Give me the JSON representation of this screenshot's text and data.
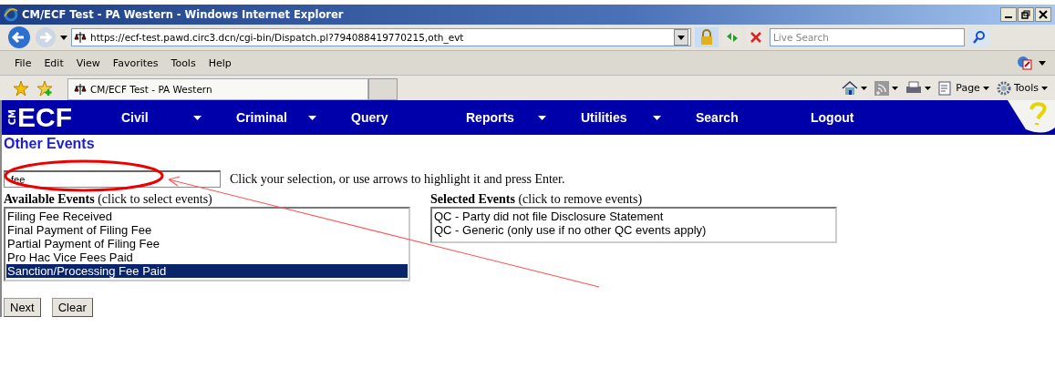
{
  "window": {
    "title": "CM/ECF Test - PA Western - Windows Internet Explorer"
  },
  "address_bar": {
    "url": "https://ecf-test.pawd.circ3.dcn/cgi-bin/Dispatch.pl?794088419770215,oth_evt"
  },
  "search": {
    "placeholder": "Live Search"
  },
  "menu_bar": [
    "File",
    "Edit",
    "View",
    "Favorites",
    "Tools",
    "Help"
  ],
  "tab": {
    "title": "CM/ECF Test - PA Western"
  },
  "command_bar": [
    {
      "kind": "home"
    },
    {
      "kind": "feed"
    },
    {
      "kind": "print"
    },
    {
      "kind": "page",
      "label": "Page"
    },
    {
      "kind": "tools",
      "label": "Tools"
    }
  ],
  "nav": {
    "logo": "ECF",
    "logo_side": "CM",
    "items": [
      {
        "label": "Civil",
        "dropdown": true
      },
      {
        "label": "Criminal",
        "dropdown": true
      },
      {
        "label": "Query",
        "dropdown": false
      },
      {
        "label": "Reports",
        "dropdown": true
      },
      {
        "label": "Utilities",
        "dropdown": true
      },
      {
        "label": "Search",
        "dropdown": false
      },
      {
        "label": "Logout",
        "dropdown": false
      }
    ]
  },
  "page_title": "Other Events",
  "filter": {
    "value": "fee",
    "hint": "Click your selection, or use arrows to highlight it and press Enter."
  },
  "available": {
    "heading": "Available Events",
    "note": "(click to select events)",
    "items": [
      {
        "label": "Filing Fee Received",
        "selected": false
      },
      {
        "label": "Final Payment of Filing Fee",
        "selected": false
      },
      {
        "label": "Partial Payment of Filing Fee",
        "selected": false
      },
      {
        "label": "Pro Hac Vice Fees Paid",
        "selected": false
      },
      {
        "label": "Sanction/Processing Fee Paid",
        "selected": true
      }
    ]
  },
  "selected_events": {
    "heading": "Selected Events",
    "note": "(click to remove events)",
    "items": [
      {
        "label": "QC - Party did not file Disclosure Statement"
      },
      {
        "label": "QC - Generic (only use if no other QC events apply)"
      }
    ]
  },
  "buttons": [
    "Next",
    "Clear"
  ]
}
